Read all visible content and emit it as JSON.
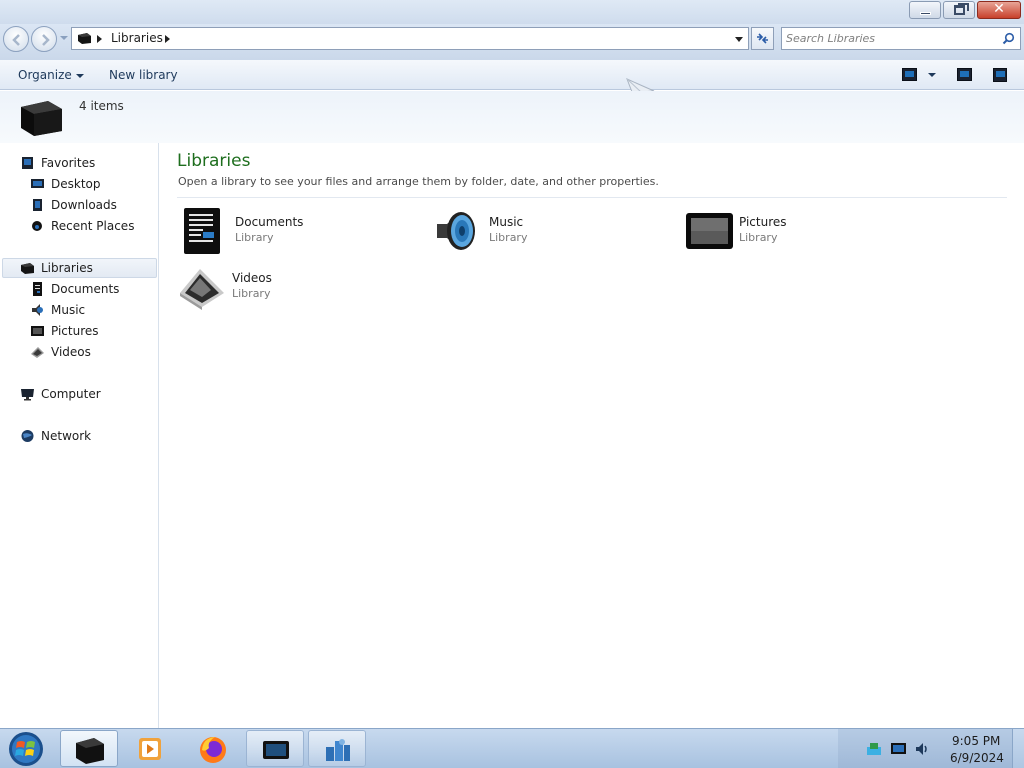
{
  "window": {
    "controls": {
      "minimize": "minimize",
      "maximize": "restore",
      "close": "✕"
    }
  },
  "address": {
    "path": "Libraries",
    "search_placeholder": "Search Libraries",
    "refresh_icon": "refresh-icon"
  },
  "toolbar": {
    "organize_label": "Organize",
    "new_library_label": "New library"
  },
  "info": {
    "item_count": "4 items"
  },
  "nav": {
    "favorites_label": "Favorites",
    "favorites": [
      {
        "label": "Desktop",
        "icon": "desktop-icon"
      },
      {
        "label": "Downloads",
        "icon": "downloads-icon"
      },
      {
        "label": "Recent Places",
        "icon": "recent-places-icon"
      }
    ],
    "libraries_label": "Libraries",
    "libraries": [
      {
        "label": "Documents",
        "icon": "documents-icon"
      },
      {
        "label": "Music",
        "icon": "music-icon"
      },
      {
        "label": "Pictures",
        "icon": "pictures-icon"
      },
      {
        "label": "Videos",
        "icon": "videos-icon"
      }
    ],
    "computer_label": "Computer",
    "network_label": "Network"
  },
  "content": {
    "title": "Libraries",
    "description": "Open a library to see your files and arrange them by folder, date, and other properties.",
    "libraries": [
      {
        "name": "Documents",
        "type": "Library"
      },
      {
        "name": "Music",
        "type": "Library"
      },
      {
        "name": "Pictures",
        "type": "Library"
      },
      {
        "name": "Videos",
        "type": "Library"
      }
    ]
  },
  "taskbar": {
    "apps": [
      "windows-explorer",
      "media-player",
      "firefox",
      "tablet-app",
      "file-manager"
    ],
    "time": "9:05 PM",
    "date": "6/9/2024"
  },
  "colors": {
    "title_green": "#1e6e1e",
    "link_blue": "#1e395b"
  }
}
